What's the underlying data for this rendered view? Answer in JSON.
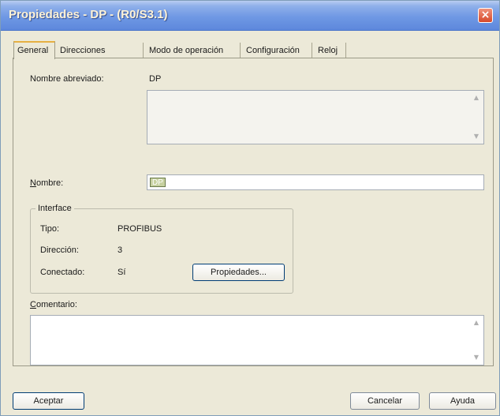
{
  "window": {
    "title": "Propiedades - DP - (R0/S3.1)",
    "close_glyph": "×"
  },
  "tabs": [
    {
      "label": "General",
      "active": true
    },
    {
      "label": "Direcciones",
      "active": false
    },
    {
      "label": "Modo de operación",
      "active": false
    },
    {
      "label": "Configuración",
      "active": false
    },
    {
      "label": "Reloj",
      "active": false
    }
  ],
  "general": {
    "short_name_label": "Nombre abreviado:",
    "short_name_value": "DP",
    "name_label": "Nombre:",
    "name_value": "DP",
    "comment_label": "Comentario:"
  },
  "interface": {
    "title": "Interface",
    "type_label": "Tipo:",
    "type_value": "PROFIBUS",
    "address_label": "Dirección:",
    "address_value": "3",
    "connected_label": "Conectado:",
    "connected_value": "Sí",
    "properties_button": "Propiedades..."
  },
  "footer": {
    "accept_button": "Aceptar",
    "cancel_button": "Cancelar",
    "help_button": "Ayuda"
  },
  "icons": {
    "scroll_up": "scroll-up-arrow-icon",
    "scroll_down": "scroll-down-arrow-icon",
    "close": "close-icon"
  },
  "colors": {
    "titlebar": "#6f98e4",
    "dialog_bg": "#ece9d8",
    "close_button": "#d6492a"
  }
}
